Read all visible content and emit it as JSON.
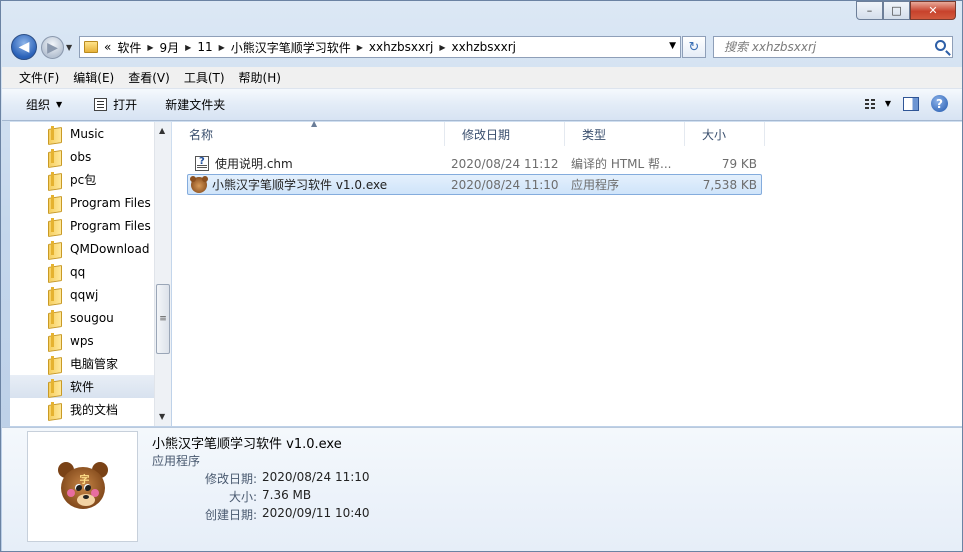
{
  "window": {
    "minimize_glyph": "–",
    "maximize_glyph": "□",
    "close_glyph": "✕"
  },
  "address": {
    "overflow": "«",
    "crumbs": [
      "软件",
      "9月",
      "11",
      "小熊汉字笔顺学习软件",
      "xxhzbsxxrj",
      "xxhzbsxxrj"
    ]
  },
  "search": {
    "placeholder": "搜索 xxhzbsxxrj"
  },
  "menubar": [
    "文件(F)",
    "编辑(E)",
    "查看(V)",
    "工具(T)",
    "帮助(H)"
  ],
  "commands": {
    "organize": "组织",
    "open": "打开",
    "new_folder": "新建文件夹",
    "help": "?"
  },
  "nav_tree": [
    "Music",
    "obs",
    "pc包",
    "Program Files",
    "Program Files",
    "QMDownload",
    "qq",
    "qqwj",
    "sougou",
    "wps",
    "电脑管家",
    "软件",
    "我的文档"
  ],
  "nav_selected_index": 11,
  "columns": {
    "name": "名称",
    "modified": "修改日期",
    "type": "类型",
    "size": "大小"
  },
  "files": [
    {
      "name": "使用说明.chm",
      "modified": "2020/08/24 11:12",
      "type": "编译的 HTML 帮...",
      "size": "79 KB",
      "icon": "chm-help-icon",
      "selected": false
    },
    {
      "name": "小熊汉字笔顺学习软件 v1.0.exe",
      "modified": "2020/08/24 11:10",
      "type": "应用程序",
      "size": "7,538 KB",
      "icon": "bear-app-icon",
      "selected": true
    }
  ],
  "details": {
    "title": "小熊汉字笔顺学习软件 v1.0.exe",
    "type": "应用程序",
    "props": [
      {
        "key": "修改日期:",
        "value": "2020/08/24 11:10"
      },
      {
        "key": "大小:",
        "value": "7.36 MB"
      },
      {
        "key": "创建日期:",
        "value": "2020/09/11 10:40"
      }
    ]
  },
  "colors": {
    "selection": "#cfe4fa",
    "selection_border": "#84acdd",
    "chrome": "#c5d7ec"
  }
}
